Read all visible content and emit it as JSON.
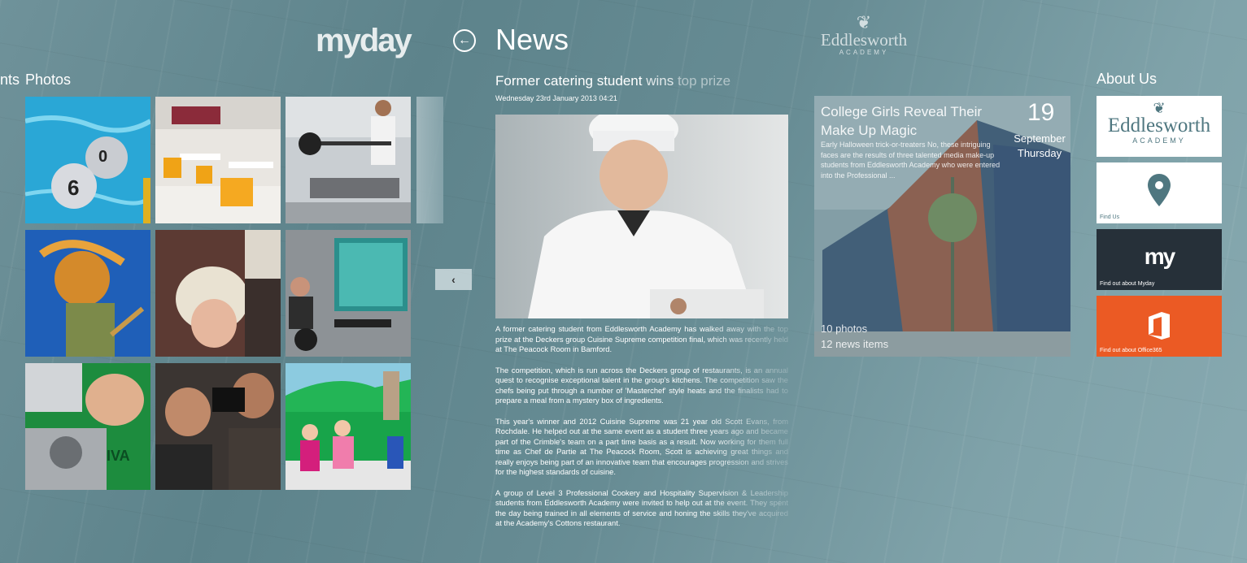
{
  "header": {
    "logo": "myday",
    "back_icon": "back-arrow-icon",
    "title": "News",
    "school_logo_name": "Eddlesworth",
    "school_logo_sub": "ACADEMY"
  },
  "photos_section": {
    "prev_section_label": "nts",
    "label": "Photos",
    "tiles": [
      "water-polo-photo",
      "cafeteria-photo",
      "gym-bench-press-photo",
      "guitarist-photo",
      "hairdressing-photo",
      "computer-lab-photo",
      "mechanic-photo",
      "camera-crew-photo",
      "children-greenscreen-photo"
    ],
    "nav_prev_icon": "chevron-left-icon",
    "nav_prev_glyph": "‹"
  },
  "article": {
    "headline_part1": "Former catering student ",
    "headline_part2": "wins ",
    "headline_part3": "top prize",
    "date": "Wednesday 23rd January 2013 04:21",
    "paragraphs": [
      "A former catering student from Eddlesworth Academy has walked away with the top prize at the Deckers group Cuisine Supreme competition final, which was recently held at The Peacock Room in Bamford.",
      "The competition, which is run across the Deckers group of restaurants, is an annual quest to recognise exceptional talent in the group's kitchens. The competition saw the chefs being put through a number of 'Masterchef' style heats and the finalists had to prepare a meal from a mystery box of ingredients.",
      "This year's winner and 2012 Cuisine Supreme was 21 year old Scott Evans, from Rochdale. He helped out at the same event as a student three years ago and became part of the Crimble's team on a part time basis as a result. Now working for them full time as Chef de Partie at The Peacock Room, Scott is achieving great things and really enjoys being part of an innovative team that encourages progression and strives for the highest standards of cuisine.",
      "A group of Level 3 Professional Cookery and Hospitality Supervision & Leadership students from Eddlesworth Academy were invited to help out at the event. They spent the day being trained in all elements of service and honing the skills they've acquired at the Academy's Cottons restaurant."
    ]
  },
  "event": {
    "title": "College Girls Reveal Their Make Up Magic",
    "excerpt": "Early Halloween trick-or-treaters No, these intriguing faces are the results of three talented media make-up students from Eddlesworth Academy who were entered into the Professional ...",
    "day": "19",
    "month": "September",
    "weekday": "Thursday",
    "photos_count": "10 photos",
    "news_count": "12 news items"
  },
  "about": {
    "title": "About Us",
    "tile_logo_name": "Eddlesworth",
    "tile_logo_sub": "ACADEMY",
    "find_us": "Find Us",
    "myday_mark": "my",
    "find_myday": "Find out about Myday",
    "find_office": "Find out about Office365"
  },
  "colors": {
    "background": "#678c94",
    "myday_tile": "#263039",
    "office_tile": "#eb5a24",
    "brand_teal": "#4f7780"
  }
}
